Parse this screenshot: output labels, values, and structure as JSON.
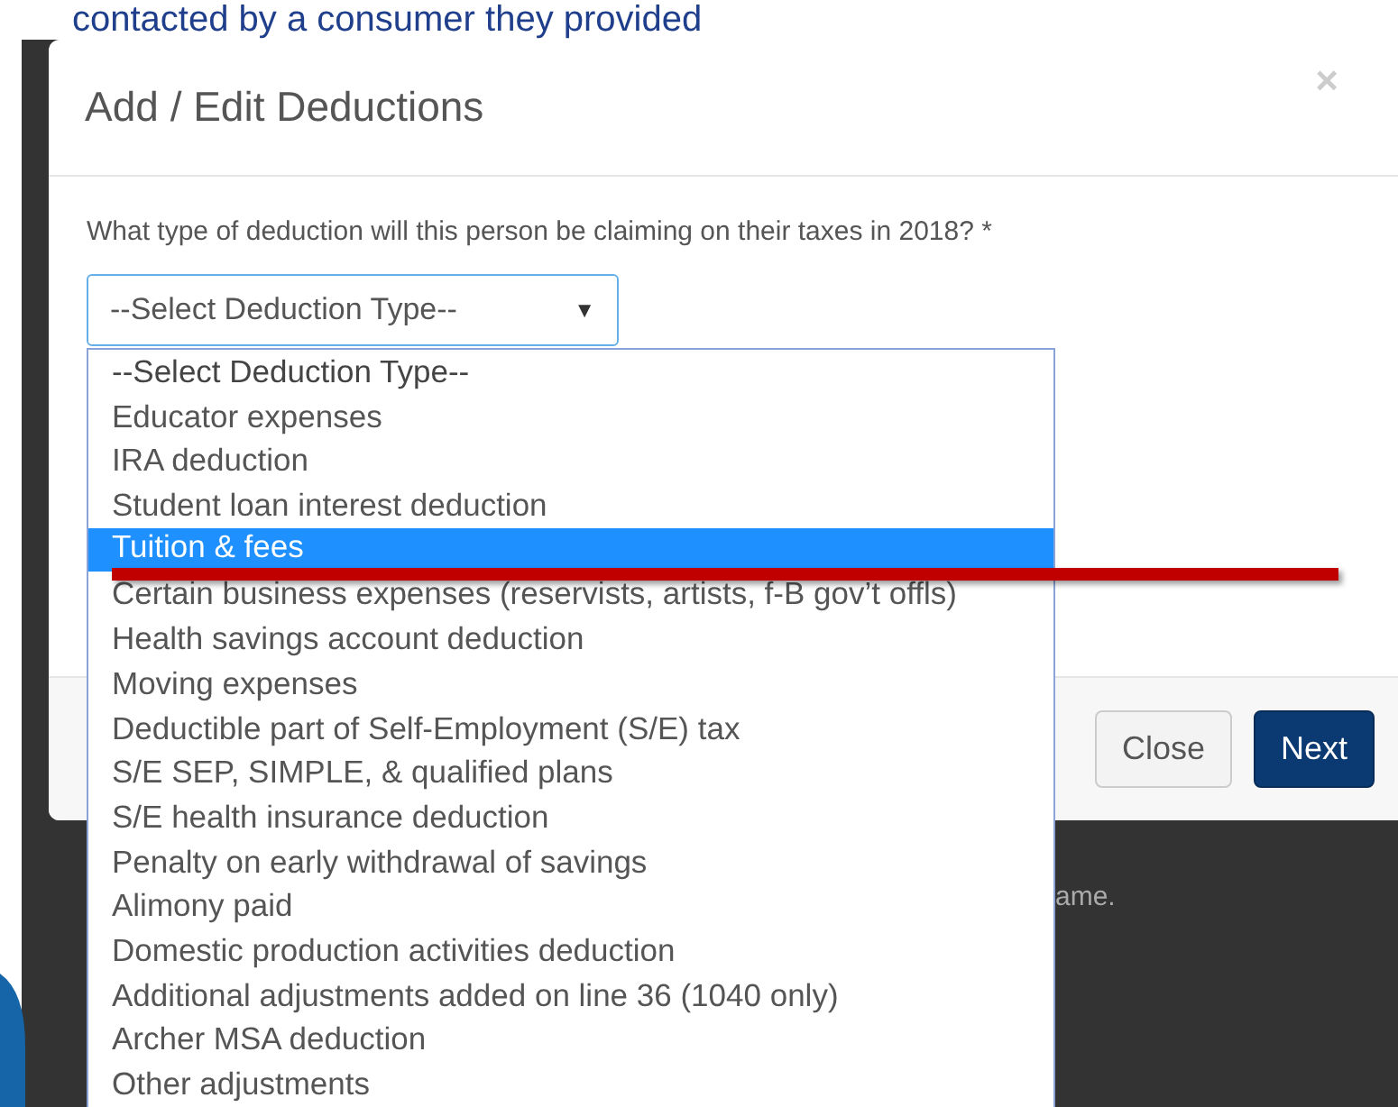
{
  "slide_text": "contacted by a consumer they provided",
  "modal": {
    "title": "Add / Edit Deductions",
    "close": "×",
    "question": "What type of deduction will this person be claiming on their taxes in 2018? *",
    "select": {
      "value": "--Select Deduction Type--",
      "caret": "▼",
      "options": [
        {
          "label": "--Select Deduction Type--",
          "selected": true
        },
        {
          "label": "Educator expenses",
          "selected": false
        },
        {
          "label": "IRA deduction",
          "selected": false
        },
        {
          "label": "Student loan interest deduction",
          "selected": false
        },
        {
          "label": "Tuition & fees",
          "selected": false,
          "highlighted": true
        },
        {
          "label": "Certain business expenses (reservists, artists, f-B gov’t offls)",
          "selected": false
        },
        {
          "label": "Health savings account deduction",
          "selected": false
        },
        {
          "label": "Moving expenses",
          "selected": false
        },
        {
          "label": "Deductible part of Self-Employment (S/E) tax",
          "selected": false
        },
        {
          "label": "S/E SEP, SIMPLE, & qualified plans",
          "selected": false
        },
        {
          "label": "S/E health insurance deduction",
          "selected": false
        },
        {
          "label": "Penalty on early withdrawal of savings",
          "selected": false
        },
        {
          "label": "Alimony paid",
          "selected": false
        },
        {
          "label": "Domestic production activities deduction",
          "selected": false
        },
        {
          "label": "Additional adjustments added on line 36 (1040 only)",
          "selected": false
        },
        {
          "label": "Archer MSA deduction",
          "selected": false
        },
        {
          "label": "Other adjustments",
          "selected": false
        }
      ]
    },
    "buttons": [
      {
        "label": "Close",
        "kind": "secondary"
      },
      {
        "label": "Next",
        "kind": "primary"
      }
    ]
  },
  "background_text": "ame."
}
